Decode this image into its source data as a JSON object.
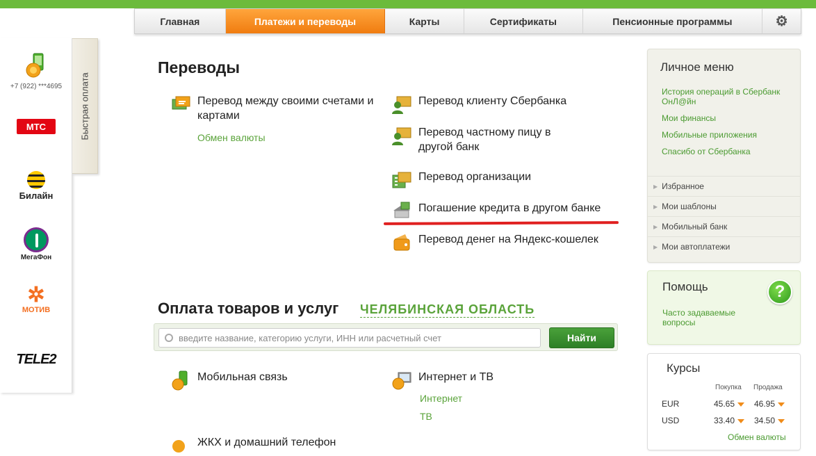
{
  "nav": {
    "tabs": [
      {
        "label": "Главная",
        "active": false
      },
      {
        "label": "Платежи и переводы",
        "active": true
      },
      {
        "label": "Карты",
        "active": false
      },
      {
        "label": "Сертификаты",
        "active": false
      },
      {
        "label": "Пенсионные программы",
        "active": false
      }
    ],
    "settings_icon": "gear-icon"
  },
  "quick_pay": {
    "tab_label": "Быстрая оплата",
    "phone_number": "+7 (922) ***4695",
    "operators": [
      "МТС",
      "Билайн",
      "МегаФон",
      "МОТИВ",
      "TELE2"
    ]
  },
  "transfers": {
    "title": "Переводы",
    "left": [
      {
        "label": "Перевод между своими счетами и картами",
        "sublinks": [
          "Обмен валюты"
        ]
      }
    ],
    "right": [
      {
        "label": "Перевод клиенту Сбербанка"
      },
      {
        "label": "Перевод частному пицу в другой банк"
      },
      {
        "label": "Перевод организации"
      },
      {
        "label": "Погашение кредита в другом банке"
      },
      {
        "label": "Перевод денег на Яндекс-кошелек"
      }
    ]
  },
  "payments": {
    "title": "Оплата товаров и услуг",
    "region": "ЧЕЛЯБИНСКАЯ ОБЛАСТЬ",
    "search_placeholder": "введите название, категорию услуги, ИНН или расчетный счет",
    "search_button": "Найти",
    "items": [
      {
        "label": "Мобильная связь",
        "sublinks": []
      },
      {
        "label": "Интернет и ТВ",
        "sublinks": [
          "Интернет",
          "ТВ"
        ]
      },
      {
        "label": "ЖКХ и домашний телефон"
      }
    ]
  },
  "personal_menu": {
    "title": "Личное меню",
    "links": [
      "История операций в Сбербанк ОнЛ@йн",
      "Мои финансы",
      "Мобильные приложения",
      "Спасибо от Сбербанка"
    ],
    "items": [
      "Избранное",
      "Мои шаблоны",
      "Мобильный банк",
      "Мои автоплатежи"
    ]
  },
  "help": {
    "title": "Помощь",
    "link": "Часто задаваемые вопросы",
    "icon": "question-icon"
  },
  "rates": {
    "title": "Курсы",
    "col_buy": "Покупка",
    "col_sell": "Продажа",
    "rows": [
      {
        "currency": "EUR",
        "buy": "45.65",
        "sell": "46.95"
      },
      {
        "currency": "USD",
        "buy": "33.40",
        "sell": "34.50"
      }
    ],
    "exchange_link": "Обмен валюты"
  },
  "colors": {
    "accent_green": "#5aa33a",
    "active_tab": "#f07c10",
    "highlight_line": "#e02020"
  }
}
